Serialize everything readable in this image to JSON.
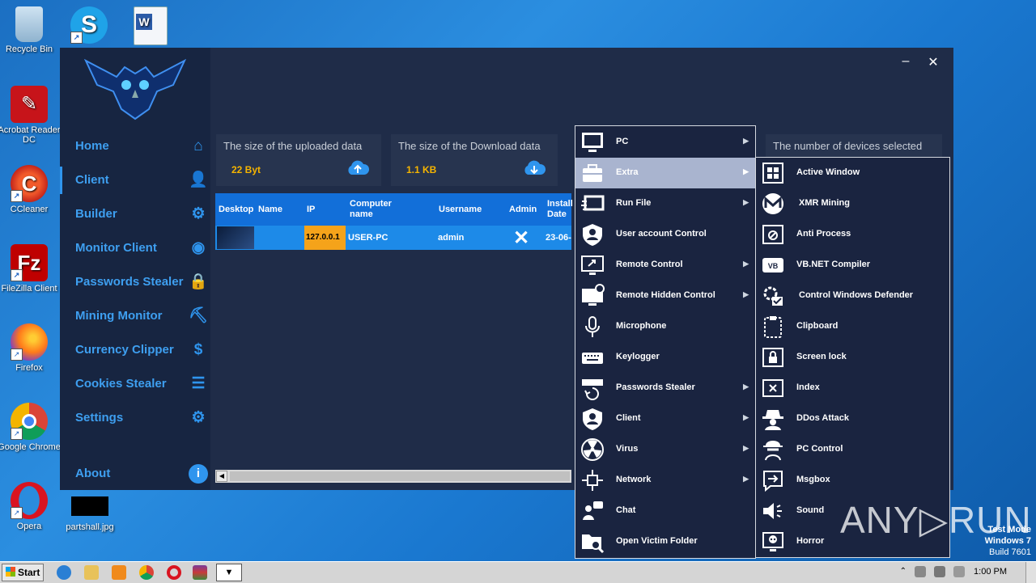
{
  "desktop": {
    "icons": [
      {
        "label": "Recycle Bin"
      },
      {
        "label": "Acrobat Reader DC"
      },
      {
        "label": "CCleaner"
      },
      {
        "label": "FileZilla Client"
      },
      {
        "label": "Firefox"
      },
      {
        "label": "Google Chrome"
      },
      {
        "label": "Opera"
      },
      {
        "label": "partshall.jpg"
      }
    ]
  },
  "sidebar": {
    "items": [
      {
        "label": "Home",
        "icon": "home-icon"
      },
      {
        "label": "Client",
        "icon": "user-icon"
      },
      {
        "label": "Builder",
        "icon": "gear-icon"
      },
      {
        "label": "Monitor Client",
        "icon": "eye-icon"
      },
      {
        "label": "Passwords Stealer",
        "icon": "lock-icon"
      },
      {
        "label": "Mining Monitor",
        "icon": "pickaxe-icon"
      },
      {
        "label": "Currency Clipper",
        "icon": "coin-icon"
      },
      {
        "label": "Cookies Stealer",
        "icon": "list-icon"
      },
      {
        "label": "Settings",
        "icon": "user-gear-icon"
      },
      {
        "label": "About",
        "icon": "info-icon"
      }
    ]
  },
  "window": {
    "minimize": "–",
    "close": "✕"
  },
  "stats": {
    "uploaded": {
      "title": "The size of the uploaded data",
      "value": "22 Byt"
    },
    "downloaded": {
      "title": "The size of the Download data",
      "value": "1.1 KB"
    },
    "devices": {
      "title": "The number of devices selected"
    }
  },
  "grid": {
    "columns": [
      "Desktop",
      "Name",
      "IP",
      "Computer name",
      "Username",
      "Admin",
      "Install Date"
    ],
    "row": {
      "name": "",
      "ip": "127.0.0.1",
      "computer": "USER-PC",
      "username": "admin",
      "admin": "✕",
      "install_date": "23-06-2"
    }
  },
  "context_menu": {
    "items": [
      {
        "label": "PC",
        "submenu": true
      },
      {
        "label": "Extra",
        "submenu": true,
        "highlighted": true
      },
      {
        "label": "Run File",
        "submenu": true
      },
      {
        "label": "User account Control",
        "submenu": false
      },
      {
        "label": "Remote Control",
        "submenu": true
      },
      {
        "label": "Remote Hidden Control",
        "submenu": true
      },
      {
        "label": "Microphone",
        "submenu": false
      },
      {
        "label": "Keylogger",
        "submenu": false
      },
      {
        "label": "Passwords Stealer",
        "submenu": true
      },
      {
        "label": "Client",
        "submenu": true
      },
      {
        "label": "Virus",
        "submenu": true
      },
      {
        "label": "Network",
        "submenu": true
      },
      {
        "label": "Chat",
        "submenu": false
      },
      {
        "label": "Open Victim Folder",
        "submenu": false
      }
    ]
  },
  "submenu_extra": {
    "items": [
      {
        "label": "Active Window"
      },
      {
        "label": "XMR Mining"
      },
      {
        "label": "Anti Process"
      },
      {
        "label": "VB.NET Compiler"
      },
      {
        "label": "Control Windows Defender"
      },
      {
        "label": "Clipboard"
      },
      {
        "label": "Screen lock"
      },
      {
        "label": "Index"
      },
      {
        "label": "DDos Attack"
      },
      {
        "label": "PC Control"
      },
      {
        "label": "Msgbox"
      },
      {
        "label": "Sound"
      },
      {
        "label": "Horror"
      }
    ]
  },
  "taskbar": {
    "start": "Start",
    "time": "1:00 PM"
  },
  "watermark": "ANY▷RUN",
  "test_mode": {
    "line1": "Test Mode",
    "line2": "Windows 7",
    "line3": "Build 7601"
  }
}
